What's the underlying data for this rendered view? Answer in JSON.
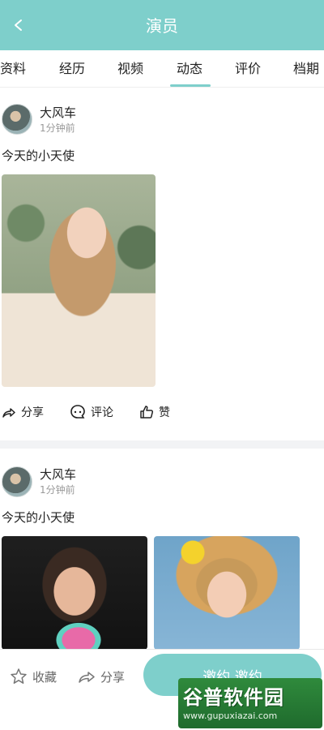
{
  "header": {
    "title": "演员"
  },
  "tabs": [
    {
      "label": "资料"
    },
    {
      "label": "经历"
    },
    {
      "label": "视频"
    },
    {
      "label": "动态",
      "active": true
    },
    {
      "label": "评价"
    },
    {
      "label": "档期"
    }
  ],
  "posts": [
    {
      "author": "大风车",
      "time": "1分钟前",
      "text": "今天的小天使",
      "actions": {
        "share": "分享",
        "comment": "评论",
        "like": "赞"
      }
    },
    {
      "author": "大风车",
      "time": "1分钟前",
      "text": "今天的小天使"
    }
  ],
  "bottom_bar": {
    "favorite": "收藏",
    "share": "分享",
    "invite": "邀约 邀约"
  },
  "watermark": {
    "logo": "谷普软件园",
    "url": "www.gupuxiazai.com"
  },
  "colors": {
    "accent": "#7ecfcb",
    "divider": "#f2f3f5"
  },
  "icons": [
    "back-arrow-icon",
    "share-icon",
    "comment-icon",
    "like-icon",
    "star-icon"
  ]
}
